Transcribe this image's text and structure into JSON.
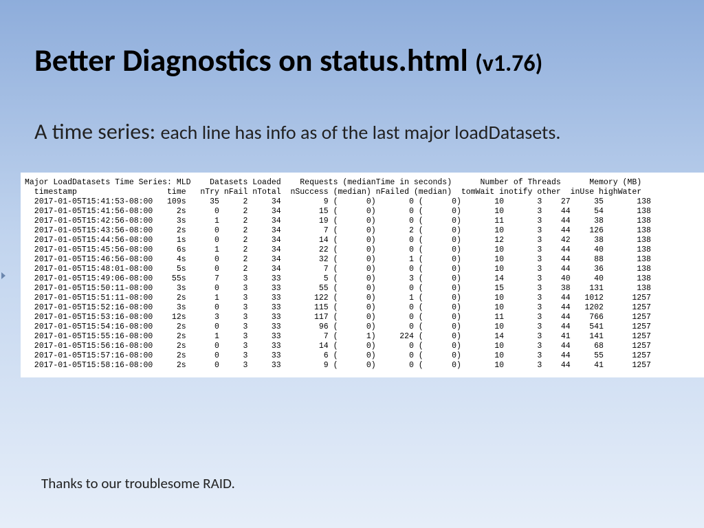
{
  "title": {
    "main": "Better Diagnostics on status.html ",
    "ver": "(v1.76)"
  },
  "subtitle": {
    "lead": "A time series: ",
    "rest": "each line has info as of the last major loadDatasets."
  },
  "footer": "Thanks to our troublesome RAID.",
  "hdr1": "Major LoadDatasets Time Series: MLD    Datasets Loaded    Requests (medianTime in seconds)      Number of Threads      Memory (MB)",
  "hdr2": "  timestamp                   time   nTry nFail nTotal  nSuccess (median) nFailed (median)  tomWait inotify other  inUse highWater",
  "rows": [
    {
      "ts": "2017-01-05T15:41:53-08:00",
      "time": "109s",
      "nTry": 35,
      "nFail": 2,
      "nTotal": 34,
      "nSucc": 9,
      "sMed": 0,
      "nFailed": 0,
      "fMed": 0,
      "tom": 10,
      "ino": 3,
      "oth": 27,
      "inUse": 35,
      "high": 138
    },
    {
      "ts": "2017-01-05T15:41:56-08:00",
      "time": "2s",
      "nTry": 0,
      "nFail": 2,
      "nTotal": 34,
      "nSucc": 15,
      "sMed": 0,
      "nFailed": 0,
      "fMed": 0,
      "tom": 10,
      "ino": 3,
      "oth": 44,
      "inUse": 54,
      "high": 138
    },
    {
      "ts": "2017-01-05T15:42:56-08:00",
      "time": "3s",
      "nTry": 1,
      "nFail": 2,
      "nTotal": 34,
      "nSucc": 19,
      "sMed": 0,
      "nFailed": 0,
      "fMed": 0,
      "tom": 11,
      "ino": 3,
      "oth": 44,
      "inUse": 38,
      "high": 138
    },
    {
      "ts": "2017-01-05T15:43:56-08:00",
      "time": "2s",
      "nTry": 0,
      "nFail": 2,
      "nTotal": 34,
      "nSucc": 7,
      "sMed": 0,
      "nFailed": 2,
      "fMed": 0,
      "tom": 10,
      "ino": 3,
      "oth": 44,
      "inUse": 126,
      "high": 138
    },
    {
      "ts": "2017-01-05T15:44:56-08:00",
      "time": "1s",
      "nTry": 0,
      "nFail": 2,
      "nTotal": 34,
      "nSucc": 14,
      "sMed": 0,
      "nFailed": 0,
      "fMed": 0,
      "tom": 12,
      "ino": 3,
      "oth": 42,
      "inUse": 38,
      "high": 138
    },
    {
      "ts": "2017-01-05T15:45:56-08:00",
      "time": "6s",
      "nTry": 1,
      "nFail": 2,
      "nTotal": 34,
      "nSucc": 22,
      "sMed": 0,
      "nFailed": 0,
      "fMed": 0,
      "tom": 10,
      "ino": 3,
      "oth": 44,
      "inUse": 40,
      "high": 138
    },
    {
      "ts": "2017-01-05T15:46:56-08:00",
      "time": "4s",
      "nTry": 0,
      "nFail": 2,
      "nTotal": 34,
      "nSucc": 32,
      "sMed": 0,
      "nFailed": 1,
      "fMed": 0,
      "tom": 10,
      "ino": 3,
      "oth": 44,
      "inUse": 88,
      "high": 138
    },
    {
      "ts": "2017-01-05T15:48:01-08:00",
      "time": "5s",
      "nTry": 0,
      "nFail": 2,
      "nTotal": 34,
      "nSucc": 7,
      "sMed": 0,
      "nFailed": 0,
      "fMed": 0,
      "tom": 10,
      "ino": 3,
      "oth": 44,
      "inUse": 36,
      "high": 138
    },
    {
      "ts": "2017-01-05T15:49:06-08:00",
      "time": "55s",
      "nTry": 7,
      "nFail": 3,
      "nTotal": 33,
      "nSucc": 5,
      "sMed": 0,
      "nFailed": 3,
      "fMed": 0,
      "tom": 14,
      "ino": 3,
      "oth": 40,
      "inUse": 40,
      "high": 138
    },
    {
      "ts": "2017-01-05T15:50:11-08:00",
      "time": "3s",
      "nTry": 0,
      "nFail": 3,
      "nTotal": 33,
      "nSucc": 55,
      "sMed": 0,
      "nFailed": 0,
      "fMed": 0,
      "tom": 15,
      "ino": 3,
      "oth": 38,
      "inUse": 131,
      "high": 138
    },
    {
      "ts": "2017-01-05T15:51:11-08:00",
      "time": "2s",
      "nTry": 1,
      "nFail": 3,
      "nTotal": 33,
      "nSucc": 122,
      "sMed": 0,
      "nFailed": 1,
      "fMed": 0,
      "tom": 10,
      "ino": 3,
      "oth": 44,
      "inUse": 1012,
      "high": 1257
    },
    {
      "ts": "2017-01-05T15:52:16-08:00",
      "time": "3s",
      "nTry": 0,
      "nFail": 3,
      "nTotal": 33,
      "nSucc": 115,
      "sMed": 0,
      "nFailed": 0,
      "fMed": 0,
      "tom": 10,
      "ino": 3,
      "oth": 44,
      "inUse": 1202,
      "high": 1257
    },
    {
      "ts": "2017-01-05T15:53:16-08:00",
      "time": "12s",
      "nTry": 3,
      "nFail": 3,
      "nTotal": 33,
      "nSucc": 117,
      "sMed": 0,
      "nFailed": 0,
      "fMed": 0,
      "tom": 11,
      "ino": 3,
      "oth": 44,
      "inUse": 766,
      "high": 1257
    },
    {
      "ts": "2017-01-05T15:54:16-08:00",
      "time": "2s",
      "nTry": 0,
      "nFail": 3,
      "nTotal": 33,
      "nSucc": 96,
      "sMed": 0,
      "nFailed": 0,
      "fMed": 0,
      "tom": 10,
      "ino": 3,
      "oth": 44,
      "inUse": 541,
      "high": 1257
    },
    {
      "ts": "2017-01-05T15:55:16-08:00",
      "time": "2s",
      "nTry": 1,
      "nFail": 3,
      "nTotal": 33,
      "nSucc": 7,
      "sMed": 1,
      "nFailed": 224,
      "fMed": 0,
      "tom": 14,
      "ino": 3,
      "oth": 41,
      "inUse": 141,
      "high": 1257
    },
    {
      "ts": "2017-01-05T15:56:16-08:00",
      "time": "2s",
      "nTry": 0,
      "nFail": 3,
      "nTotal": 33,
      "nSucc": 14,
      "sMed": 0,
      "nFailed": 0,
      "fMed": 0,
      "tom": 10,
      "ino": 3,
      "oth": 44,
      "inUse": 68,
      "high": 1257
    },
    {
      "ts": "2017-01-05T15:57:16-08:00",
      "time": "2s",
      "nTry": 0,
      "nFail": 3,
      "nTotal": 33,
      "nSucc": 6,
      "sMed": 0,
      "nFailed": 0,
      "fMed": 0,
      "tom": 10,
      "ino": 3,
      "oth": 44,
      "inUse": 55,
      "high": 1257
    },
    {
      "ts": "2017-01-05T15:58:16-08:00",
      "time": "2s",
      "nTry": 0,
      "nFail": 3,
      "nTotal": 33,
      "nSucc": 9,
      "sMed": 0,
      "nFailed": 0,
      "fMed": 0,
      "tom": 10,
      "ino": 3,
      "oth": 44,
      "inUse": 41,
      "high": 1257
    }
  ]
}
